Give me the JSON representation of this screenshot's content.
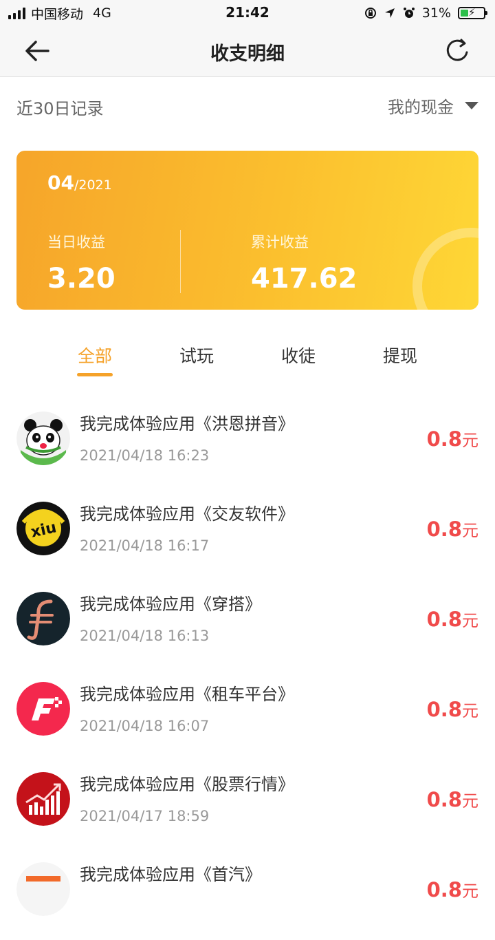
{
  "status_bar": {
    "carrier": "中国移动",
    "network": "4G",
    "time": "21:42",
    "battery": "31%"
  },
  "nav": {
    "title": "收支明细"
  },
  "filter": {
    "period_label": "近30日记录",
    "account_label": "我的现金"
  },
  "summary": {
    "month": "04",
    "year": "/2021",
    "daily_label": "当日收益",
    "daily_value": "3.20",
    "total_label": "累计收益",
    "total_value": "417.62"
  },
  "tabs": [
    {
      "label": "全部",
      "active": true
    },
    {
      "label": "试玩",
      "active": false
    },
    {
      "label": "收徒",
      "active": false
    },
    {
      "label": "提现",
      "active": false
    }
  ],
  "records": [
    {
      "title": "我完成体验应用《洪恩拼音》",
      "time": "2021/04/18 16:23",
      "amount": "0.8",
      "unit": "元",
      "icon": "panda-app-icon"
    },
    {
      "title": "我完成体验应用《交友软件》",
      "time": "2021/04/18 16:17",
      "amount": "0.8",
      "unit": "元",
      "icon": "xiu-app-icon"
    },
    {
      "title": "我完成体验应用《穿搭》",
      "time": "2021/04/18 16:13",
      "amount": "0.8",
      "unit": "元",
      "icon": "fashion-app-icon"
    },
    {
      "title": "我完成体验应用《租车平台》",
      "time": "2021/04/18 16:07",
      "amount": "0.8",
      "unit": "元",
      "icon": "car-rental-app-icon"
    },
    {
      "title": "我完成体验应用《股票行情》",
      "time": "2021/04/17 18:59",
      "amount": "0.8",
      "unit": "元",
      "icon": "stock-app-icon"
    },
    {
      "title": "我完成体验应用《首汽》",
      "time": "",
      "amount": "0.8",
      "unit": "元",
      "icon": "shouqi-app-icon"
    }
  ],
  "colors": {
    "accent": "#f5a229",
    "amount": "#f04b4b",
    "card_start": "#f6a52a",
    "card_end": "#fed736"
  }
}
